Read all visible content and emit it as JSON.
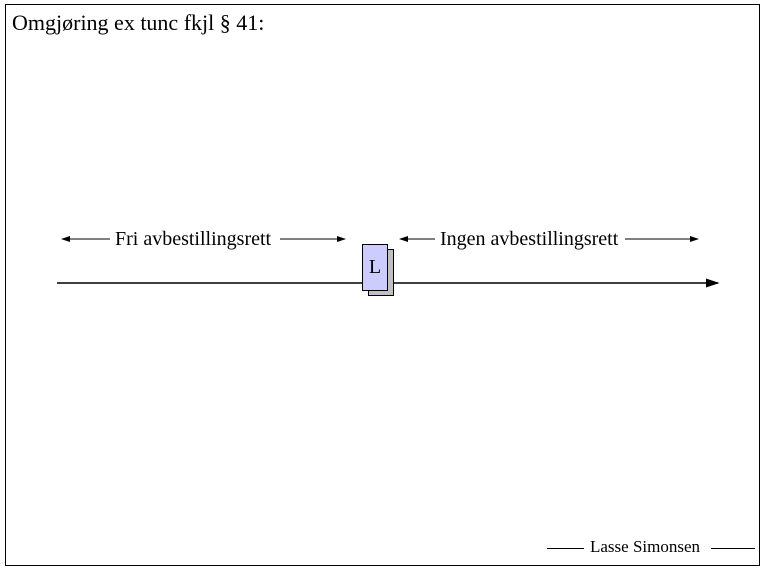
{
  "title": "Omgjøring ex tunc  fkjl § 41:",
  "left_label": "Fri avbestillingsrett",
  "right_label": "Ingen avbestillingsrett",
  "box_label": "L",
  "author": "Lasse Simonsen",
  "colors": {
    "box_fill": "#ccccff",
    "shadow_fill": "#c0c0c0",
    "line": "#000000"
  }
}
